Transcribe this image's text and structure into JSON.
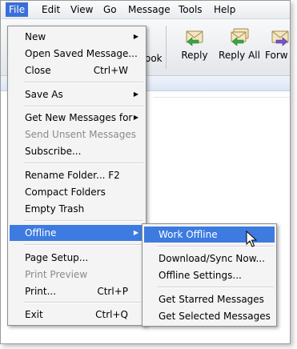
{
  "menubar": {
    "items": [
      {
        "label": "File"
      },
      {
        "label": "Edit"
      },
      {
        "label": "View"
      },
      {
        "label": "Go"
      },
      {
        "label": "Message"
      },
      {
        "label": "Tools"
      },
      {
        "label": "Help"
      }
    ]
  },
  "toolbar": {
    "partial_label": "ook",
    "reply_label": "Reply",
    "reply_all_label": "Reply All",
    "forward_label": "Forw"
  },
  "file_menu": {
    "new": "New",
    "open_saved": "Open Saved Message...",
    "close": "Close",
    "close_shortcut": "Ctrl+W",
    "save_as": "Save As",
    "get_new": "Get New Messages for",
    "send_unsent": "Send Unsent Messages",
    "subscribe": "Subscribe...",
    "rename_folder": "Rename Folder...  F2",
    "compact": "Compact Folders",
    "empty_trash": "Empty Trash",
    "offline": "Offline",
    "page_setup": "Page Setup...",
    "print_preview": "Print Preview",
    "print": "Print...",
    "print_shortcut": "Ctrl+P",
    "exit": "Exit",
    "exit_shortcut": "Ctrl+Q"
  },
  "offline_submenu": {
    "work_offline": "Work Offline",
    "download_sync": "Download/Sync Now...",
    "offline_settings": "Offline Settings...",
    "get_starred": "Get Starred Messages",
    "get_selected": "Get Selected Messages"
  }
}
